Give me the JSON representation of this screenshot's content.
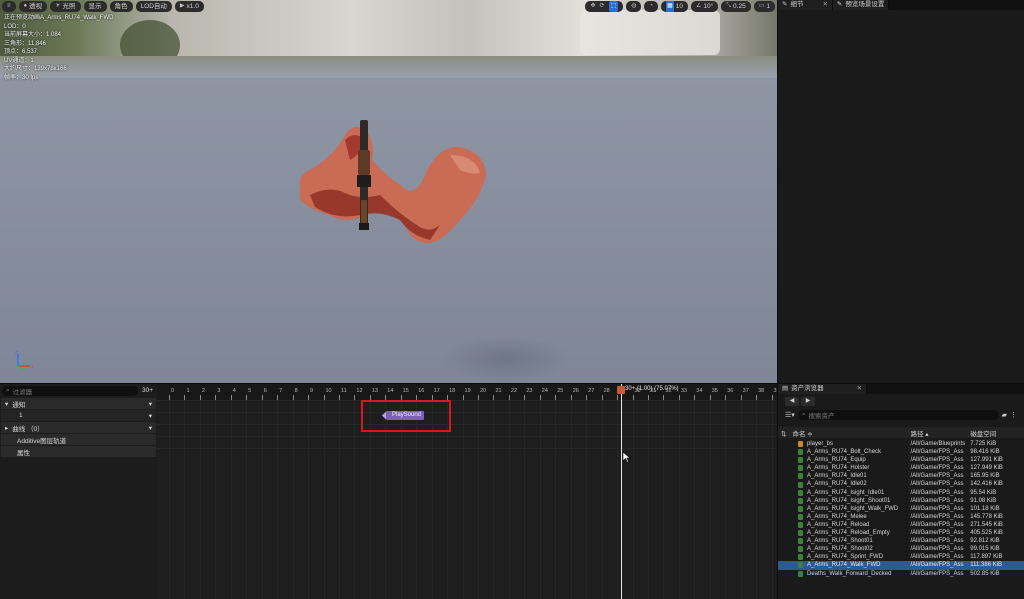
{
  "viewport": {
    "toolbar_left": [
      {
        "icon": "menu-icon",
        "label": ""
      },
      {
        "icon": "sphere-icon",
        "label": "透视"
      },
      {
        "icon": "sun-icon",
        "label": "光照"
      },
      {
        "icon": "",
        "label": "显示"
      },
      {
        "icon": "",
        "label": "角色"
      },
      {
        "icon": "",
        "label": "LOD自动"
      },
      {
        "icon": "play-icon",
        "label": "x1.0"
      }
    ],
    "toolbar_right": [
      {
        "icon": "move-icon",
        "label": ""
      },
      {
        "icon": "rotate-icon",
        "label": ""
      },
      {
        "icon": "scale-icon",
        "label": ""
      },
      {
        "icon": "globe-icon",
        "label": ""
      },
      {
        "icon": "surface-snap-icon",
        "label": ""
      },
      {
        "icon": "grid-snap-icon",
        "label": "10"
      },
      {
        "icon": "angle-snap-icon",
        "label": "10°"
      },
      {
        "icon": "scale-snap-icon",
        "label": "0.25"
      },
      {
        "icon": "camera-speed-icon",
        "label": "1"
      }
    ],
    "stats": [
      "正在预览动画A_Arms_RU74_Walk_FWD",
      "LOD：0",
      "当前屏幕大小：1.084",
      "三角形：11,846",
      "顶点：6,537",
      "UV通道：1",
      "大约尺寸：139x78x166",
      "帧率：30 fps"
    ]
  },
  "right_top": {
    "tabs": [
      {
        "icon": "pencil-icon",
        "label": "细节"
      },
      {
        "icon": "pencil-icon",
        "label": "预览场景设置"
      }
    ]
  },
  "tracks": {
    "search_placeholder": "过滤器",
    "frame_count": "30+",
    "rows": [
      {
        "label": "通知",
        "expand": "▾"
      },
      {
        "label": "1",
        "expand": "▾"
      },
      {
        "label": "曲线 （0）",
        "expand": "▾"
      },
      {
        "label": "Additive图层轨道",
        "expand": ""
      },
      {
        "label": "属性",
        "expand": ""
      }
    ]
  },
  "timeline": {
    "ticks": [
      "0",
      "1",
      "2",
      "3",
      "4",
      "5",
      "6",
      "7",
      "8",
      "9",
      "10",
      "11",
      "12",
      "13",
      "14",
      "15",
      "16",
      "17",
      "18",
      "19",
      "20",
      "21",
      "22",
      "23",
      "24",
      "25",
      "26",
      "27",
      "28",
      "29",
      "30",
      "31",
      "32",
      "33",
      "34",
      "35",
      "36",
      "37",
      "38",
      "39"
    ],
    "playhead_label": "30+ (1.00) (75.07%)",
    "notify_label": "PlaySound"
  },
  "assets": {
    "tab_label": "资产浏览器",
    "search_placeholder": "搜索资产",
    "columns": {
      "name": "命名 ≑",
      "path": "路径 ▴",
      "size": "磁盘空间"
    },
    "rows": [
      {
        "name": "player_bs",
        "path": "/All/Game/Blueprints",
        "size": "7.725 KiB",
        "icon": "blueprint",
        "selected": false
      },
      {
        "name": "A_Arms_RU74_Bolt_Check",
        "path": "/All/Game/FPS_Ass",
        "size": "98.416 KiB",
        "icon": "anim",
        "selected": false
      },
      {
        "name": "A_Arms_RU74_Equip",
        "path": "/All/Game/FPS_Ass",
        "size": "127.991 KiB",
        "icon": "anim",
        "selected": false
      },
      {
        "name": "A_Arms_RU74_Holster",
        "path": "/All/Game/FPS_Ass",
        "size": "127.949 KiB",
        "icon": "anim",
        "selected": false
      },
      {
        "name": "A_Arms_RU74_Idle01",
        "path": "/All/Game/FPS_Ass",
        "size": "165.95 KiB",
        "icon": "anim",
        "selected": false
      },
      {
        "name": "A_Arms_RU74_Idle02",
        "path": "/All/Game/FPS_Ass",
        "size": "142.416 KiB",
        "icon": "anim",
        "selected": false
      },
      {
        "name": "A_Arms_RU74_Isight_Idle01",
        "path": "/All/Game/FPS_Ass",
        "size": "95.54 KiB",
        "icon": "anim",
        "selected": false
      },
      {
        "name": "A_Arms_RU74_Isight_Shoot01",
        "path": "/All/Game/FPS_Ass",
        "size": "91.08 KiB",
        "icon": "anim",
        "selected": false
      },
      {
        "name": "A_Arms_RU74_Isight_Walk_FWD",
        "path": "/All/Game/FPS_Ass",
        "size": "101.18 KiB",
        "icon": "anim",
        "selected": false
      },
      {
        "name": "A_Arms_RU74_Melee",
        "path": "/All/Game/FPS_Ass",
        "size": "145.778 KiB",
        "icon": "anim",
        "selected": false
      },
      {
        "name": "A_Arms_RU74_Reload",
        "path": "/All/Game/FPS_Ass",
        "size": "271.545 KiB",
        "icon": "anim",
        "selected": false
      },
      {
        "name": "A_Arms_RU74_Reload_Empty",
        "path": "/All/Game/FPS_Ass",
        "size": "405.525 KiB",
        "icon": "anim",
        "selected": false
      },
      {
        "name": "A_Arms_RU74_Shoot01",
        "path": "/All/Game/FPS_Ass",
        "size": "92.812 KiB",
        "icon": "anim",
        "selected": false
      },
      {
        "name": "A_Arms_RU74_Shoot02",
        "path": "/All/Game/FPS_Ass",
        "size": "99.015 KiB",
        "icon": "anim",
        "selected": false
      },
      {
        "name": "A_Arms_RU74_Sprint_FWD",
        "path": "/All/Game/FPS_Ass",
        "size": "117.897 KiB",
        "icon": "anim",
        "selected": false
      },
      {
        "name": "A_Arms_RU74_Walk_FWD",
        "path": "/All/Game/FPS_Ass",
        "size": "111.386 KiB",
        "icon": "anim",
        "selected": true
      },
      {
        "name": "Deaths_Walk_Forward_Decked",
        "path": "/All/Game/FPS_Ass",
        "size": "502.85 KiB",
        "icon": "anim",
        "selected": false
      }
    ]
  },
  "colors": {
    "selection": "#2f5a8f",
    "notify": "#7b62b8",
    "highlight": "#e0141e",
    "playhead_marker": "#c65a3a"
  }
}
